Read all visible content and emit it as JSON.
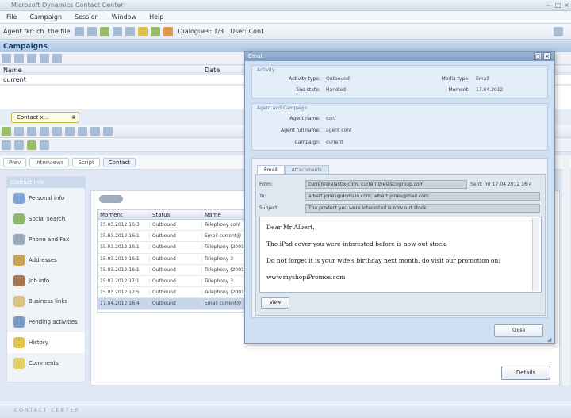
{
  "window": {
    "title": "Microsoft Dynamics Contact Center"
  },
  "menu": [
    "File",
    "Campaign",
    "Session",
    "Window",
    "Help"
  ],
  "toolbar": {
    "agent": "Agent fkr: ch. the file",
    "status": "Dialogues: 1/3",
    "user": "User: Conf"
  },
  "campaigns": {
    "header": "Campaigns",
    "col1": "Name",
    "col2": "Date",
    "row1": "current"
  },
  "contact_tab": "Contact x...",
  "nav": {
    "prev": "Prev",
    "interviews": "Interviews",
    "script": "Script",
    "contact": "Contact"
  },
  "left_panel": {
    "header": "Contact Info",
    "items": [
      {
        "label": "Personal info",
        "icon": "person-icon",
        "color": "#7da7d8"
      },
      {
        "label": "Social search",
        "icon": "people-icon",
        "color": "#8fb86a"
      },
      {
        "label": "Phone and Fax",
        "icon": "phone-icon",
        "color": "#9aa9bd"
      },
      {
        "label": "Addresses",
        "icon": "address-icon",
        "color": "#c7a34d"
      },
      {
        "label": "Job info",
        "icon": "job-icon",
        "color": "#a8744b"
      },
      {
        "label": "Business links",
        "icon": "link-icon",
        "color": "#d9c184"
      },
      {
        "label": "Pending activities",
        "icon": "clock-icon",
        "color": "#7a9cc9"
      },
      {
        "label": "History",
        "icon": "history-icon",
        "color": "#e0c34a"
      },
      {
        "label": "Comments",
        "icon": "comment-icon",
        "color": "#e3cf60"
      }
    ]
  },
  "history": {
    "columns": [
      "Moment",
      "Status",
      "Name"
    ],
    "rows": [
      [
        "15.03.2012 16:3",
        "Outbound",
        "Telephony conf"
      ],
      [
        "15.03.2012 16:1",
        "Outbound",
        "Email current@"
      ],
      [
        "15.03.2012 16:1",
        "Outbound",
        "Telephony (2001"
      ],
      [
        "15.03.2012 16:1",
        "Outbound",
        "Telephony 3"
      ],
      [
        "15.03.2012 16:1",
        "Outbound",
        "Telephony (2001"
      ],
      [
        "15.03.2012 17:1",
        "Outbound",
        "Telephony 3"
      ],
      [
        "15.03.2012 17:5",
        "Outbound",
        "Telephony (2001"
      ],
      [
        "17.04.2012 16:4",
        "Outbound",
        "Email current@"
      ]
    ],
    "selected_index": 7
  },
  "details_button": "Details",
  "status_brand": "CONTACT CENTER",
  "modal": {
    "title": "Email",
    "activity_group": "Activity",
    "activity_type_label": "Activity type:",
    "activity_type": "Outbound",
    "end_state_label": "End state:",
    "end_state": "Handled",
    "media_type_label": "Media type:",
    "media_type": "Email",
    "moment_label": "Moment:",
    "moment": "17.04.2012",
    "agent_group": "Agent and Campaign",
    "agent_name_label": "Agent name:",
    "agent_name": "conf",
    "agent_full_label": "Agent full name:",
    "agent_full": "agent conf",
    "campaign_label": "Campaign:",
    "campaign": "current",
    "tab_email": "Email",
    "tab_attachments": "Attachments",
    "from_label": "From:",
    "from": "current@elastix.com; current@elastixgroup.com",
    "sent_label": "Sent: ",
    "sent": "Sent: mr 17.04.2012 16:4",
    "to_label": "To:",
    "to": "albert.jones@domain.com; albert.jones@mail.com",
    "subject_label": "Subject:",
    "subject": "The product you were interested is now out stock",
    "body": [
      "Dear Mr Albert,",
      "The iPad cover you were interested before is now out stock.",
      "Do not forget it is your wife's birthday next month, do visit our promotion on:",
      "www.myshopiPromos.com"
    ],
    "view_button": "View",
    "close_button": "Close"
  }
}
